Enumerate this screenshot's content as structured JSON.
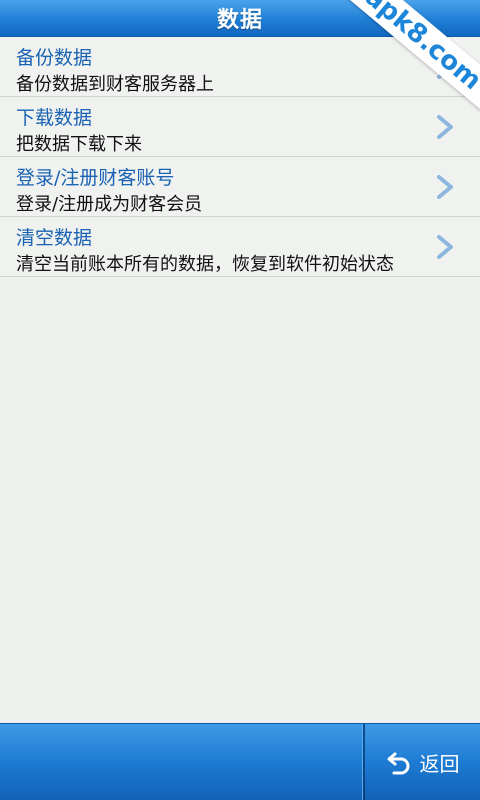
{
  "header": {
    "title": "数据"
  },
  "watermark": {
    "text": "apk8.com"
  },
  "list": {
    "items": [
      {
        "title": "备份数据",
        "subtitle": "备份数据到财客服务器上"
      },
      {
        "title": "下载数据",
        "subtitle": "把数据下载下来"
      },
      {
        "title": "登录/注册财客账号",
        "subtitle": "登录/注册成为财客会员"
      },
      {
        "title": "清空数据",
        "subtitle": "清空当前账本所有的数据，恢复到软件初始状态"
      }
    ]
  },
  "footer": {
    "back_label": "返回",
    "back_icon": "undo-arrow-icon"
  },
  "colors": {
    "accent_blue": "#1f7fd6",
    "title_text": "#1a62b3",
    "background": "#eef1ee",
    "chevron": "#8db7df"
  }
}
